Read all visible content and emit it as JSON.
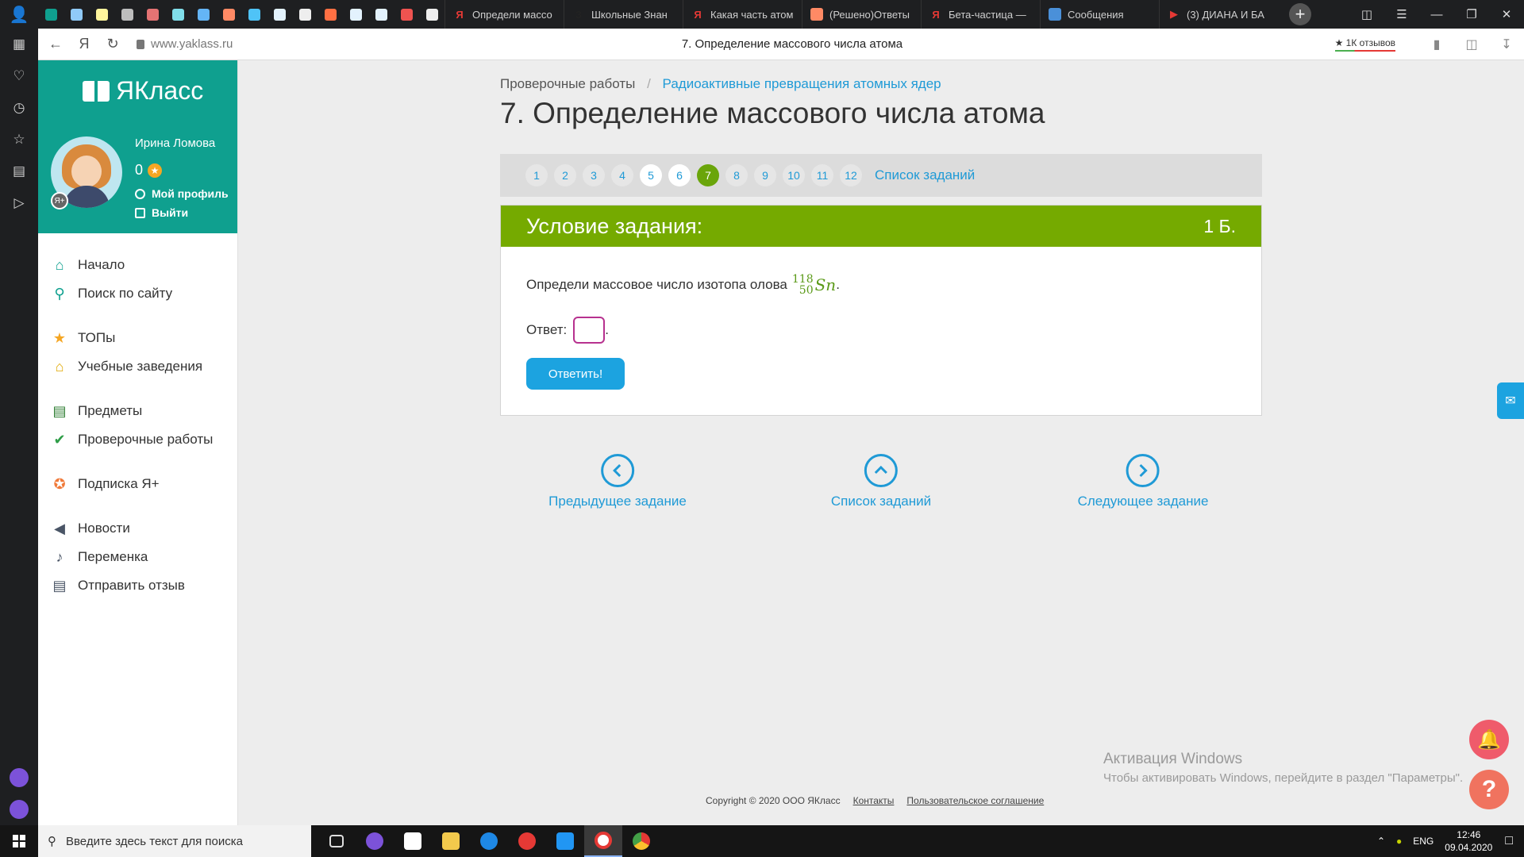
{
  "browser": {
    "tabs": [
      {
        "label": "Определи массо",
        "fav_letter": "Я",
        "fav_color": "#e53935"
      },
      {
        "label": "Школьные Знан",
        "fav_letter": "З",
        "fav_color": "#222222"
      },
      {
        "label": "Какая часть атом",
        "fav_letter": "Я",
        "fav_color": "#e53935"
      },
      {
        "label": "(Решено)Ответы",
        "fav_letter": "",
        "fav_color": "#ff8a65"
      },
      {
        "label": "Бета-частица —",
        "fav_letter": "Я",
        "fav_color": "#e53935"
      },
      {
        "label": "Сообщения",
        "fav_letter": "",
        "fav_color": "#4a90d9"
      },
      {
        "label": "(3) ДИАНА И БА",
        "fav_letter": "▶",
        "fav_color": "#e53935"
      }
    ],
    "url": "www.yaklass.ru",
    "page_title": "7. Определение массового числа атома",
    "reviews_badge": "★ 1К отзывов"
  },
  "site": {
    "logo_text": "ЯКласс",
    "user": {
      "name": "Ирина Ломова",
      "points": "0",
      "badge": "Я+",
      "profile_link": "Мой профиль",
      "logout_link": "Выйти"
    },
    "menu": [
      {
        "label": "Начало",
        "icon": "home-icon",
        "color": "#0fa08f"
      },
      {
        "label": "Поиск по сайту",
        "icon": "search-icon",
        "color": "#0fa08f"
      },
      {
        "label": "ТОПы",
        "icon": "star-icon",
        "color": "#f5a623"
      },
      {
        "label": "Учебные заведения",
        "icon": "school-icon",
        "color": "#e0a800"
      },
      {
        "label": "Предметы",
        "icon": "book-icon",
        "color": "#2e7d32"
      },
      {
        "label": "Проверочные работы",
        "icon": "check-icon",
        "color": "#2e9d47"
      },
      {
        "label": "Подписка Я+",
        "icon": "plus-badge-icon",
        "color": "#f07a3a"
      },
      {
        "label": "Новости",
        "icon": "megaphone-icon",
        "color": "#4a5566"
      },
      {
        "label": "Переменка",
        "icon": "bell-icon",
        "color": "#4a5566"
      },
      {
        "label": "Отправить отзыв",
        "icon": "chat-icon",
        "color": "#4a5566"
      }
    ]
  },
  "main": {
    "breadcrumb": {
      "root": "Проверочные работы",
      "current": "Радиоактивные превращения атомных ядер"
    },
    "title": "7. Определение массового числа атома",
    "pager": {
      "pages": [
        "1",
        "2",
        "3",
        "4",
        "5",
        "6",
        "7",
        "8",
        "9",
        "10",
        "11",
        "12"
      ],
      "done": [
        "5",
        "6"
      ],
      "current": "7",
      "list_link": "Список заданий"
    },
    "task": {
      "header": "Условие задания:",
      "points": "1 Б.",
      "question": "Определи массовое число изотопа олова",
      "isotope": {
        "mass": "118",
        "atomic": "50",
        "symbol": "Sn"
      },
      "answer_label": "Ответ:",
      "answer_value": "",
      "answer_suffix": ".",
      "submit": "Ответить!"
    },
    "nav": {
      "prev": "Предыдущее задание",
      "list": "Список заданий",
      "next": "Следующее задание"
    },
    "footer": {
      "copyright": "Copyright © 2020 ООО ЯКласс",
      "contacts": "Контакты",
      "agreement": "Пользовательское соглашение"
    }
  },
  "windows": {
    "activation_title": "Активация Windows",
    "activation_text": "Чтобы активировать Windows, перейдите в раздел \"Параметры\".",
    "search_placeholder": "Введите здесь текст для поиска",
    "language": "ENG",
    "time": "12:46",
    "date": "09.04.2020"
  },
  "colors": {
    "accent_green": "#75aa00",
    "sidebar_teal": "#0fa08f",
    "link_blue": "#1f9ad6",
    "button_blue": "#1ca3e0"
  }
}
